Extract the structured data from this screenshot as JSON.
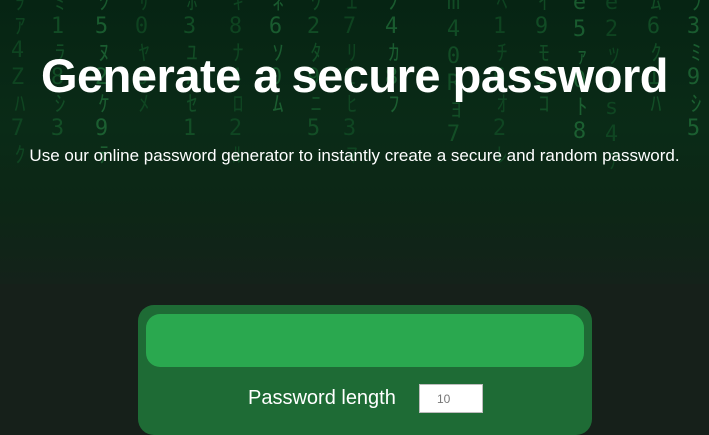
{
  "hero": {
    "title": "Generate a secure password",
    "subtitle": "Use our online password generator to instantly create a secure and random password."
  },
  "generator": {
    "password_value": "",
    "length_label": "Password length",
    "length_value": "10"
  },
  "background": {
    "style": "green digital code rain",
    "colors": {
      "hero_dark": "#062413",
      "code": "#1f7a3a",
      "page": "#16201a",
      "card": "#1e6b35",
      "output": "#2aa84f"
    }
  }
}
